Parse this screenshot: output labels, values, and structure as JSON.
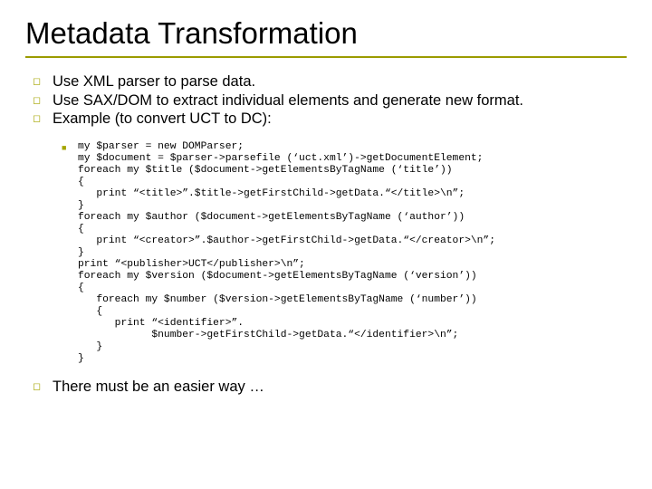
{
  "title": "Metadata Transformation",
  "bullets": {
    "b1": "Use XML parser to parse data.",
    "b2": "Use SAX/DOM to extract individual elements and generate new format.",
    "b3": "Example (to convert UCT to DC):",
    "b4": "There must be an easier way …"
  },
  "code": "my $parser = new DOMParser;\nmy $document = $parser->parsefile (‘uct.xml’)->getDocumentElement;\nforeach my $title ($document->getElementsByTagName (‘title’))\n{\n   print “<title>”.$title->getFirstChild->getData.“</title>\\n”;\n}\nforeach my $author ($document->getElementsByTagName (‘author’))\n{\n   print “<creator>”.$author->getFirstChild->getData.“</creator>\\n”;\n}\nprint “<publisher>UCT</publisher>\\n”;\nforeach my $version ($document->getElementsByTagName (‘version’))\n{\n   foreach my $number ($version->getElementsByTagName (‘number’))\n   {\n      print “<identifier>”.\n            $number->getFirstChild->getData.“</identifier>\\n”;\n   }\n}"
}
